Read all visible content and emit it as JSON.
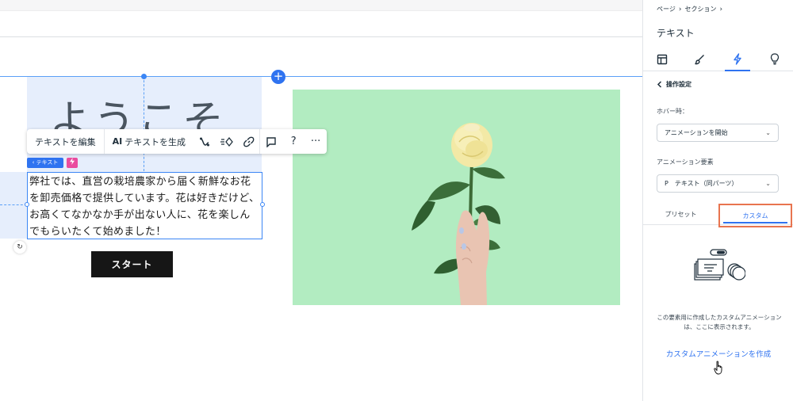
{
  "canvas": {
    "welcome_heading": "ようこそ",
    "body_text": "弊社では、直営の栽培農家から届く新鮮なお花を卸売価格で提供しています。花は好きだけど、お高くてなかなか手が出ない人に、花を楽しんでもらいたくて始めました！",
    "start_button": "スタート",
    "tag_text": "‹ テキスト",
    "add_section_symbol": "+",
    "photo_bg_color": "#b2ecc1"
  },
  "toolbar": {
    "edit_text": "テキストを編集",
    "ai_prefix": "AI",
    "ai_generate": "テキストを生成",
    "icons": [
      "animation-icon",
      "interactions-icon",
      "link-icon",
      "comment-icon",
      "help-icon",
      "more-icon"
    ],
    "help_glyph": "?",
    "more_glyph": "···"
  },
  "panel": {
    "breadcrumb": [
      "ページ",
      "セクション"
    ],
    "title": "テキスト",
    "tabs": [
      "layout-icon",
      "design-icon",
      "animation-icon",
      "ai-bulb-icon"
    ],
    "active_tab": 2,
    "back_label": "操作設定",
    "hover_label": "ホバー時：",
    "hover_value": "アニメーションを開始",
    "element_label": "アニメーション要素",
    "element_prefix": "P",
    "element_value": "テキスト（同パーツ）",
    "seg_preset": "プリセット",
    "seg_custom": "カスタム",
    "empty_text": "この要素用に作成したカスタムアニメーションは、ここに表示されます。",
    "create_link": "カスタムアニメーションを作成"
  },
  "colors": {
    "accent": "#2f73f0",
    "highlight_border": "#e8744f",
    "tag_pink": "#ea4c9e"
  }
}
